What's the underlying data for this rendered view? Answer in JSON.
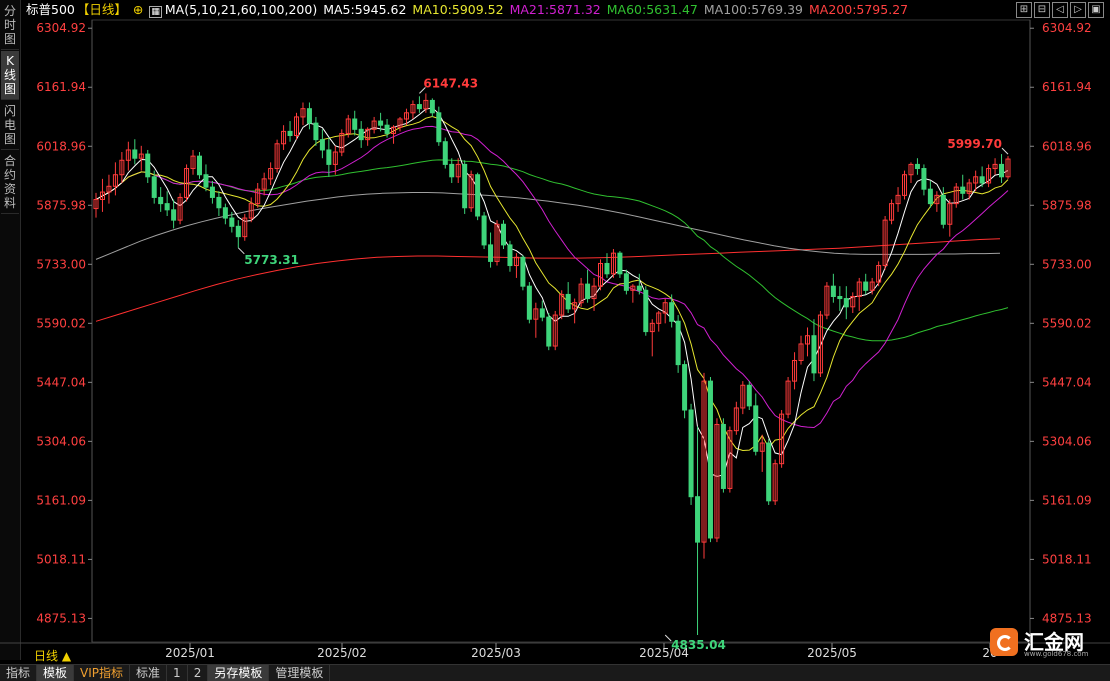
{
  "left_tabs": [
    {
      "label": "分时图",
      "active": false
    },
    {
      "label": "K线图",
      "active": true
    },
    {
      "label": "闪电图",
      "active": false
    },
    {
      "label": "合约资料",
      "active": false
    }
  ],
  "header": {
    "symbol": "标普500",
    "period": "【日线】",
    "ma_group": "MA(5,10,21,60,100,200)",
    "ma5": "MA5:5945.62",
    "ma10": "MA10:5909.52",
    "ma21": "MA21:5871.32",
    "ma60": "MA60:5631.47",
    "ma100": "MA100:5769.39",
    "ma200": "MA200:5795.27"
  },
  "colors": {
    "up": "#ff3b3b",
    "down": "#3ed47a",
    "ma5": "#ffffff",
    "ma10": "#e6e630",
    "ma21": "#d020d0",
    "ma60": "#30c030",
    "ma100": "#a0a0a0",
    "ma200": "#ff3030",
    "axis_text": "#ff4040"
  },
  "y_ticks": [
    "6304.92",
    "6161.94",
    "6018.96",
    "5875.98",
    "5733.00",
    "5590.02",
    "5447.04",
    "5304.06",
    "5161.09",
    "5018.11",
    "4875.13"
  ],
  "x_ticks": [
    "2025/01",
    "2025/02",
    "2025/03",
    "2025/04",
    "2025/05",
    "20"
  ],
  "annotations": {
    "high": "6147.43",
    "low_jan": "5773.31",
    "low_apr": "4835.04",
    "last": "5999.70"
  },
  "bottom_bar": {
    "period_label": "日线 ▲",
    "buttons": [
      "指标",
      "模板",
      "VIP指标",
      "标准",
      "1",
      "2",
      "另存模板",
      "管理模板"
    ]
  },
  "logo": {
    "text": "汇金网",
    "url": "www.gold678.com"
  },
  "chart_data": {
    "type": "candlestick",
    "ylim": [
      4818,
      6320
    ],
    "candles": [
      {
        "o": 5868,
        "h": 5906,
        "l": 5846,
        "c": 5890
      },
      {
        "o": 5890,
        "h": 5940,
        "l": 5860,
        "c": 5908
      },
      {
        "o": 5908,
        "h": 5950,
        "l": 5880,
        "c": 5922
      },
      {
        "o": 5922,
        "h": 5980,
        "l": 5900,
        "c": 5950
      },
      {
        "o": 5950,
        "h": 6005,
        "l": 5930,
        "c": 5985
      },
      {
        "o": 5985,
        "h": 6030,
        "l": 5960,
        "c": 6010
      },
      {
        "o": 6010,
        "h": 6036,
        "l": 5975,
        "c": 5990
      },
      {
        "o": 5990,
        "h": 6020,
        "l": 5960,
        "c": 6000
      },
      {
        "o": 6000,
        "h": 6010,
        "l": 5930,
        "c": 5945
      },
      {
        "o": 5945,
        "h": 5960,
        "l": 5880,
        "c": 5895
      },
      {
        "o": 5895,
        "h": 5920,
        "l": 5860,
        "c": 5880
      },
      {
        "o": 5880,
        "h": 5910,
        "l": 5850,
        "c": 5865
      },
      {
        "o": 5865,
        "h": 5890,
        "l": 5820,
        "c": 5840
      },
      {
        "o": 5840,
        "h": 5905,
        "l": 5830,
        "c": 5895
      },
      {
        "o": 5895,
        "h": 5975,
        "l": 5885,
        "c": 5965
      },
      {
        "o": 5965,
        "h": 6010,
        "l": 5950,
        "c": 5995
      },
      {
        "o": 5995,
        "h": 6005,
        "l": 5940,
        "c": 5950
      },
      {
        "o": 5950,
        "h": 5975,
        "l": 5910,
        "c": 5920
      },
      {
        "o": 5920,
        "h": 5935,
        "l": 5880,
        "c": 5895
      },
      {
        "o": 5895,
        "h": 5910,
        "l": 5850,
        "c": 5870
      },
      {
        "o": 5870,
        "h": 5880,
        "l": 5830,
        "c": 5845
      },
      {
        "o": 5845,
        "h": 5860,
        "l": 5810,
        "c": 5825
      },
      {
        "o": 5825,
        "h": 5840,
        "l": 5773,
        "c": 5800
      },
      {
        "o": 5800,
        "h": 5855,
        "l": 5790,
        "c": 5845
      },
      {
        "o": 5845,
        "h": 5895,
        "l": 5835,
        "c": 5880
      },
      {
        "o": 5880,
        "h": 5930,
        "l": 5870,
        "c": 5915
      },
      {
        "o": 5915,
        "h": 5955,
        "l": 5900,
        "c": 5940
      },
      {
        "o": 5940,
        "h": 5980,
        "l": 5925,
        "c": 5965
      },
      {
        "o": 5965,
        "h": 6035,
        "l": 5955,
        "c": 6025
      },
      {
        "o": 6025,
        "h": 6070,
        "l": 6010,
        "c": 6055
      },
      {
        "o": 6055,
        "h": 6080,
        "l": 6030,
        "c": 6045
      },
      {
        "o": 6045,
        "h": 6100,
        "l": 6035,
        "c": 6090
      },
      {
        "o": 6090,
        "h": 6125,
        "l": 6070,
        "c": 6110
      },
      {
        "o": 6110,
        "h": 6125,
        "l": 6060,
        "c": 6075
      },
      {
        "o": 6075,
        "h": 6090,
        "l": 6020,
        "c": 6035
      },
      {
        "o": 6035,
        "h": 6060,
        "l": 5990,
        "c": 6010
      },
      {
        "o": 6010,
        "h": 6040,
        "l": 5945,
        "c": 5975
      },
      {
        "o": 5975,
        "h": 6020,
        "l": 5950,
        "c": 6005
      },
      {
        "o": 6005,
        "h": 6060,
        "l": 5995,
        "c": 6050
      },
      {
        "o": 6050,
        "h": 6095,
        "l": 6040,
        "c": 6085
      },
      {
        "o": 6085,
        "h": 6105,
        "l": 6045,
        "c": 6060
      },
      {
        "o": 6060,
        "h": 6080,
        "l": 6015,
        "c": 6035
      },
      {
        "o": 6035,
        "h": 6065,
        "l": 6020,
        "c": 6060
      },
      {
        "o": 6060,
        "h": 6090,
        "l": 6050,
        "c": 6080
      },
      {
        "o": 6080,
        "h": 6100,
        "l": 6055,
        "c": 6070
      },
      {
        "o": 6070,
        "h": 6085,
        "l": 6040,
        "c": 6050
      },
      {
        "o": 6050,
        "h": 6070,
        "l": 6025,
        "c": 6065
      },
      {
        "o": 6065,
        "h": 6090,
        "l": 6055,
        "c": 6085
      },
      {
        "o": 6085,
        "h": 6110,
        "l": 6070,
        "c": 6100
      },
      {
        "o": 6100,
        "h": 6130,
        "l": 6085,
        "c": 6120
      },
      {
        "o": 6120,
        "h": 6140,
        "l": 6100,
        "c": 6110
      },
      {
        "o": 6110,
        "h": 6147,
        "l": 6100,
        "c": 6130
      },
      {
        "o": 6130,
        "h": 6135,
        "l": 6090,
        "c": 6100
      },
      {
        "o": 6100,
        "h": 6115,
        "l": 6020,
        "c": 6030
      },
      {
        "o": 6030,
        "h": 6040,
        "l": 5965,
        "c": 5975
      },
      {
        "o": 5975,
        "h": 5990,
        "l": 5930,
        "c": 5945
      },
      {
        "o": 5945,
        "h": 5990,
        "l": 5930,
        "c": 5975
      },
      {
        "o": 5975,
        "h": 5985,
        "l": 5855,
        "c": 5870
      },
      {
        "o": 5870,
        "h": 5960,
        "l": 5860,
        "c": 5950
      },
      {
        "o": 5950,
        "h": 5955,
        "l": 5840,
        "c": 5850
      },
      {
        "o": 5850,
        "h": 5860,
        "l": 5770,
        "c": 5780
      },
      {
        "o": 5780,
        "h": 5810,
        "l": 5725,
        "c": 5740
      },
      {
        "o": 5740,
        "h": 5840,
        "l": 5730,
        "c": 5830
      },
      {
        "o": 5830,
        "h": 5840,
        "l": 5770,
        "c": 5780
      },
      {
        "o": 5780,
        "h": 5790,
        "l": 5715,
        "c": 5730
      },
      {
        "o": 5730,
        "h": 5760,
        "l": 5700,
        "c": 5750
      },
      {
        "o": 5750,
        "h": 5755,
        "l": 5670,
        "c": 5680
      },
      {
        "o": 5680,
        "h": 5690,
        "l": 5590,
        "c": 5600
      },
      {
        "o": 5600,
        "h": 5640,
        "l": 5555,
        "c": 5625
      },
      {
        "o": 5625,
        "h": 5645,
        "l": 5595,
        "c": 5605
      },
      {
        "o": 5605,
        "h": 5615,
        "l": 5525,
        "c": 5535
      },
      {
        "o": 5535,
        "h": 5620,
        "l": 5525,
        "c": 5610
      },
      {
        "o": 5610,
        "h": 5670,
        "l": 5600,
        "c": 5660
      },
      {
        "o": 5660,
        "h": 5690,
        "l": 5615,
        "c": 5625
      },
      {
        "o": 5625,
        "h": 5650,
        "l": 5590,
        "c": 5640
      },
      {
        "o": 5640,
        "h": 5700,
        "l": 5630,
        "c": 5685
      },
      {
        "o": 5685,
        "h": 5720,
        "l": 5640,
        "c": 5650
      },
      {
        "o": 5650,
        "h": 5700,
        "l": 5620,
        "c": 5680
      },
      {
        "o": 5680,
        "h": 5745,
        "l": 5670,
        "c": 5735
      },
      {
        "o": 5735,
        "h": 5760,
        "l": 5700,
        "c": 5710
      },
      {
        "o": 5710,
        "h": 5770,
        "l": 5700,
        "c": 5760
      },
      {
        "o": 5760,
        "h": 5765,
        "l": 5700,
        "c": 5710
      },
      {
        "o": 5710,
        "h": 5720,
        "l": 5660,
        "c": 5670
      },
      {
        "o": 5670,
        "h": 5685,
        "l": 5640,
        "c": 5680
      },
      {
        "o": 5680,
        "h": 5710,
        "l": 5660,
        "c": 5670
      },
      {
        "o": 5670,
        "h": 5680,
        "l": 5560,
        "c": 5570
      },
      {
        "o": 5570,
        "h": 5600,
        "l": 5510,
        "c": 5590
      },
      {
        "o": 5590,
        "h": 5620,
        "l": 5570,
        "c": 5615
      },
      {
        "o": 5615,
        "h": 5650,
        "l": 5590,
        "c": 5640
      },
      {
        "o": 5640,
        "h": 5660,
        "l": 5580,
        "c": 5595
      },
      {
        "o": 5595,
        "h": 5610,
        "l": 5470,
        "c": 5490
      },
      {
        "o": 5490,
        "h": 5500,
        "l": 5360,
        "c": 5380
      },
      {
        "o": 5380,
        "h": 5395,
        "l": 5150,
        "c": 5170
      },
      {
        "o": 5170,
        "h": 5340,
        "l": 4835,
        "c": 5060
      },
      {
        "o": 5060,
        "h": 5470,
        "l": 5020,
        "c": 5450
      },
      {
        "o": 5450,
        "h": 5460,
        "l": 5060,
        "c": 5070
      },
      {
        "o": 5070,
        "h": 5360,
        "l": 5060,
        "c": 5345
      },
      {
        "o": 5345,
        "h": 5360,
        "l": 5180,
        "c": 5190
      },
      {
        "o": 5190,
        "h": 5340,
        "l": 5180,
        "c": 5330
      },
      {
        "o": 5330,
        "h": 5400,
        "l": 5320,
        "c": 5385
      },
      {
        "o": 5385,
        "h": 5450,
        "l": 5370,
        "c": 5440
      },
      {
        "o": 5440,
        "h": 5450,
        "l": 5380,
        "c": 5390
      },
      {
        "o": 5390,
        "h": 5420,
        "l": 5270,
        "c": 5280
      },
      {
        "o": 5280,
        "h": 5320,
        "l": 5230,
        "c": 5300
      },
      {
        "o": 5300,
        "h": 5310,
        "l": 5150,
        "c": 5160
      },
      {
        "o": 5160,
        "h": 5260,
        "l": 5150,
        "c": 5250
      },
      {
        "o": 5250,
        "h": 5380,
        "l": 5240,
        "c": 5370
      },
      {
        "o": 5370,
        "h": 5460,
        "l": 5360,
        "c": 5450
      },
      {
        "o": 5450,
        "h": 5520,
        "l": 5430,
        "c": 5500
      },
      {
        "o": 5500,
        "h": 5560,
        "l": 5490,
        "c": 5540
      },
      {
        "o": 5540,
        "h": 5580,
        "l": 5510,
        "c": 5560
      },
      {
        "o": 5560,
        "h": 5600,
        "l": 5450,
        "c": 5470
      },
      {
        "o": 5470,
        "h": 5620,
        "l": 5460,
        "c": 5610
      },
      {
        "o": 5610,
        "h": 5690,
        "l": 5600,
        "c": 5680
      },
      {
        "o": 5680,
        "h": 5710,
        "l": 5640,
        "c": 5655
      },
      {
        "o": 5655,
        "h": 5680,
        "l": 5620,
        "c": 5650
      },
      {
        "o": 5650,
        "h": 5680,
        "l": 5600,
        "c": 5630
      },
      {
        "o": 5630,
        "h": 5665,
        "l": 5615,
        "c": 5655
      },
      {
        "o": 5655,
        "h": 5700,
        "l": 5620,
        "c": 5690
      },
      {
        "o": 5690,
        "h": 5710,
        "l": 5660,
        "c": 5670
      },
      {
        "o": 5670,
        "h": 5700,
        "l": 5660,
        "c": 5690
      },
      {
        "o": 5690,
        "h": 5740,
        "l": 5680,
        "c": 5730
      },
      {
        "o": 5730,
        "h": 5850,
        "l": 5720,
        "c": 5840
      },
      {
        "o": 5840,
        "h": 5890,
        "l": 5830,
        "c": 5880
      },
      {
        "o": 5880,
        "h": 5920,
        "l": 5860,
        "c": 5900
      },
      {
        "o": 5900,
        "h": 5960,
        "l": 5890,
        "c": 5950
      },
      {
        "o": 5950,
        "h": 5980,
        "l": 5930,
        "c": 5975
      },
      {
        "o": 5975,
        "h": 5990,
        "l": 5950,
        "c": 5965
      },
      {
        "o": 5965,
        "h": 5975,
        "l": 5900,
        "c": 5915
      },
      {
        "o": 5915,
        "h": 5935,
        "l": 5870,
        "c": 5880
      },
      {
        "o": 5880,
        "h": 5910,
        "l": 5860,
        "c": 5900
      },
      {
        "o": 5900,
        "h": 5920,
        "l": 5820,
        "c": 5830
      },
      {
        "o": 5830,
        "h": 5890,
        "l": 5800,
        "c": 5880
      },
      {
        "o": 5880,
        "h": 5930,
        "l": 5870,
        "c": 5920
      },
      {
        "o": 5920,
        "h": 5950,
        "l": 5890,
        "c": 5905
      },
      {
        "o": 5905,
        "h": 5940,
        "l": 5890,
        "c": 5930
      },
      {
        "o": 5930,
        "h": 5960,
        "l": 5910,
        "c": 5945
      },
      {
        "o": 5945,
        "h": 5970,
        "l": 5920,
        "c": 5930
      },
      {
        "o": 5930,
        "h": 5975,
        "l": 5920,
        "c": 5965
      },
      {
        "o": 5965,
        "h": 5990,
        "l": 5950,
        "c": 5975
      },
      {
        "o": 5975,
        "h": 6000,
        "l": 5930,
        "c": 5945
      },
      {
        "o": 5945,
        "h": 5995,
        "l": 5940,
        "c": 5988
      }
    ],
    "ma100": [
      5745,
      5760,
      5775,
      5790,
      5803,
      5815,
      5826,
      5836,
      5845,
      5853,
      5861,
      5868,
      5874,
      5880,
      5886,
      5891,
      5896,
      5900,
      5903,
      5905,
      5906,
      5907,
      5907,
      5906,
      5904,
      5902,
      5900,
      5897,
      5894,
      5890,
      5886,
      5881,
      5876,
      5870,
      5863,
      5856,
      5848,
      5840,
      5832,
      5824,
      5816,
      5808,
      5800,
      5792,
      5785,
      5778,
      5772,
      5767,
      5763,
      5760,
      5758,
      5757,
      5757,
      5757,
      5757,
      5757,
      5758,
      5758,
      5759,
      5759,
      5760
    ],
    "ma200": [
      5595,
      5610,
      5625,
      5640,
      5655,
      5670,
      5684,
      5697,
      5708,
      5718,
      5727,
      5735,
      5741,
      5746,
      5750,
      5752,
      5753,
      5753,
      5752,
      5751,
      5750,
      5749,
      5748,
      5748,
      5748,
      5749,
      5750,
      5752,
      5754,
      5756,
      5758,
      5760,
      5762,
      5764,
      5766,
      5768,
      5770,
      5772,
      5775,
      5778,
      5781,
      5784,
      5787,
      5790,
      5793,
      5795
    ]
  }
}
